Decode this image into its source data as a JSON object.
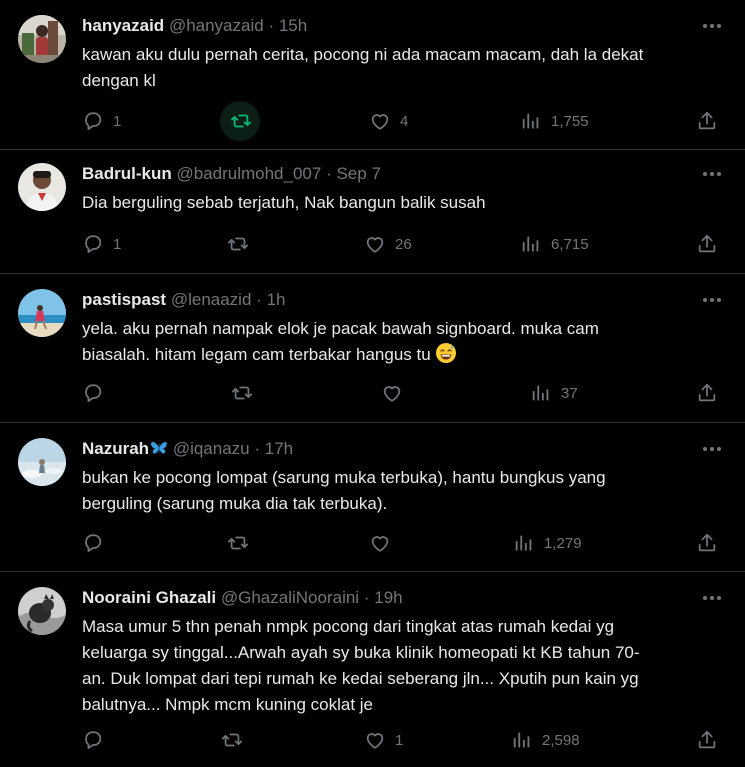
{
  "tweets": [
    {
      "display_name": "hanyazaid",
      "handle": "@hanyazaid",
      "separator": "·",
      "time": "15h",
      "text": "kawan aku dulu pernah cerita, pocong ni ada macam macam, dah la dekat\ndengan kl",
      "replies": "1",
      "retweets": "",
      "likes": "4",
      "views": "1,755",
      "retweet_highlighted": true
    },
    {
      "display_name": "Badrul-kun",
      "handle": "@badrulmohd_007",
      "separator": "·",
      "time": "Sep 7",
      "text": "Dia berguling sebab terjatuh, Nak bangun balik susah",
      "replies": "1",
      "retweets": "",
      "likes": "26",
      "views": "6,715"
    },
    {
      "display_name": "pastispast",
      "handle": "@lenaazid",
      "separator": "·",
      "time": "1h",
      "text": "yela. aku pernah nampak elok je pacak bawah signboard. muka cam\nbiasalah. hitam legam cam terbakar hangus tu",
      "emoji": "sweat-smile-emoji",
      "replies": "",
      "retweets": "",
      "likes": "",
      "views": "37"
    },
    {
      "display_name": "Nazurah",
      "display_name_badge": "butterfly-emoji",
      "handle": "@iqanazu",
      "separator": "·",
      "time": "17h",
      "text": "bukan ke pocong lompat (sarung muka terbuka), hantu bungkus yang\nberguling (sarung muka dia tak terbuka).",
      "replies": "",
      "retweets": "",
      "likes": "",
      "views": "1,279"
    },
    {
      "display_name": "Nooraini Ghazali",
      "handle": "@GhazaliNooraini",
      "separator": "·",
      "time": "19h",
      "text": "Masa umur 5 thn penah nmpk pocong dari tingkat atas rumah kedai yg\nkeluarga sy tinggal...Arwah ayah sy buka klinik homeopati kt KB tahun 70-\nan. Duk lompat dari tepi rumah ke kedai seberang jln... Xputih pun kain yg\nbalutnya... Nmpk mcm kuning coklat je",
      "replies": "",
      "retweets": "",
      "likes": "1",
      "views": "2,598"
    }
  ],
  "colors": {
    "background": "#000000",
    "text": "#e7e9ea",
    "muted": "#71767b",
    "divider": "#2f3336",
    "retweet_hover": "#00ba7c"
  },
  "icons": [
    "reply-icon",
    "retweet-icon",
    "like-icon",
    "views-icon",
    "share-icon",
    "more-icon"
  ]
}
